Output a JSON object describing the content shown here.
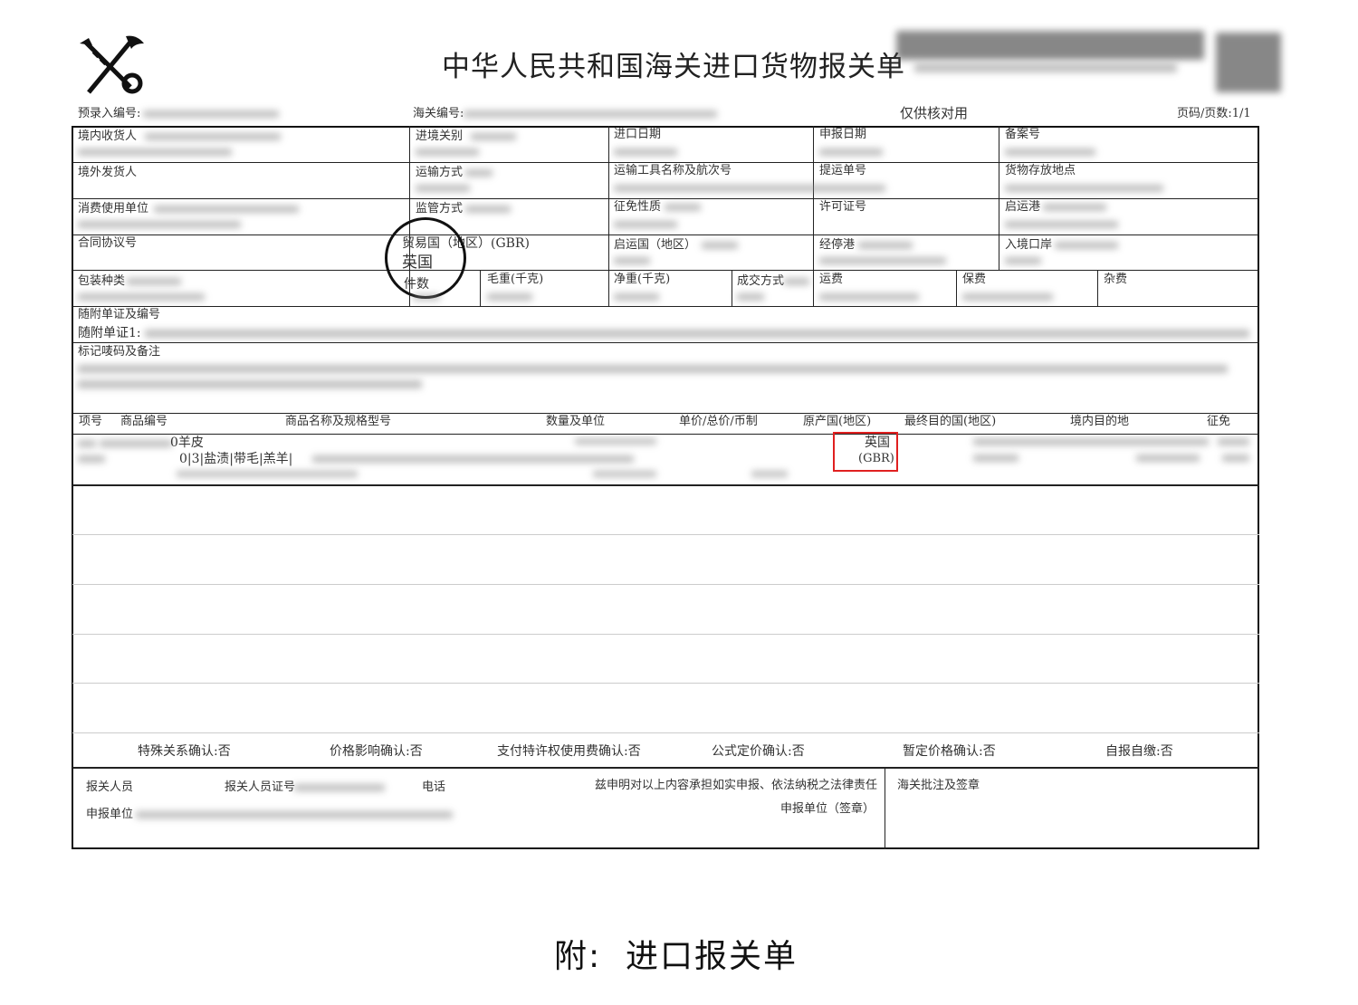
{
  "header": {
    "title": "中华人民共和国海关进口货物报关单",
    "pre_entry_label": "预录入编号:",
    "customs_no_label": "海关编号:",
    "verify_only": "仅供核对用",
    "page_label": "页码/页数:1/1"
  },
  "row1": {
    "consignee": "境内收货人",
    "entry_customs": "进境关别",
    "import_date": "进口日期",
    "declare_date": "申报日期",
    "record_no": "备案号"
  },
  "row2": {
    "shipper": "境外发货人",
    "transport_mode": "运输方式",
    "vessel": "运输工具名称及航次号",
    "bill_no": "提运单号",
    "storage": "货物存放地点"
  },
  "row3": {
    "consumer": "消费使用单位",
    "supervision": "监管方式",
    "tax_nature": "征免性质",
    "license": "许可证号",
    "dep_port": "启运港"
  },
  "row4": {
    "contract": "合同协议号",
    "trade_country_label": "贸易国（地区）(GBR)",
    "trade_country_value": "英国",
    "dep_country": "启运国（地区）",
    "stop_port": "经停港",
    "entry_port": "入境口岸"
  },
  "row5": {
    "package": "包装种类",
    "pieces": "件数",
    "gross": "毛重(千克)",
    "net": "净重(千克)",
    "deal": "成交方式",
    "freight": "运费",
    "insurance": "保费",
    "misc": "杂费"
  },
  "row6": {
    "docs": "随附单证及编号",
    "doc1": "随附单证1:"
  },
  "row7": {
    "marks": "标记唛码及备注"
  },
  "goods_header": [
    "项号",
    "商品编号",
    "商品名称及规格型号",
    "数量及单位",
    "单价/总价/币制",
    "原产国(地区)",
    "最终目的国(地区)",
    "境内目的地",
    "征免"
  ],
  "goods_item": {
    "name_line1": "0羊皮",
    "name_line2": "0|3|盐渍|带毛|羔羊|",
    "origin": "英国",
    "origin_code": "(GBR)"
  },
  "confirmations": [
    "特殊关系确认:否",
    "价格影响确认:否",
    "支付特许权使用费确认:否",
    "公式定价确认:否",
    "暂定价格确认:否",
    "自报自缴:否"
  ],
  "footer": {
    "declarant": "报关人员",
    "declarant_no": "报关人员证号",
    "phone": "电话",
    "statement": "兹申明对以上内容承担如实申报、依法纳税之法律责任",
    "declare_unit": "申报单位",
    "declare_unit_sign": "申报单位（签章）",
    "customs_remark": "海关批注及签章"
  },
  "caption": "附:  进口报关单"
}
